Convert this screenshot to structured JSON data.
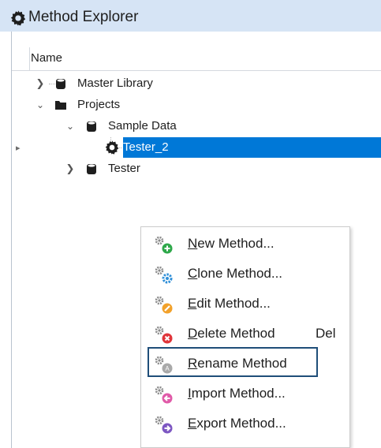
{
  "window": {
    "title": "Method Explorer",
    "icon": "gear-icon",
    "accent_color": "#0078d7",
    "title_bg": "#d6e4f5"
  },
  "grid": {
    "column_header": "Name"
  },
  "tree": {
    "items": [
      {
        "label": "Master Library",
        "icon": "database-icon",
        "state": "collapsed"
      },
      {
        "label": "Projects",
        "icon": "folder-icon",
        "state": "expanded"
      },
      {
        "label": "Sample Data",
        "icon": "database-icon",
        "state": "expanded"
      },
      {
        "label": "Tester_2",
        "icon": "gear-icon",
        "state": "leaf",
        "selected": true
      },
      {
        "label": "Tester",
        "icon": "database-icon",
        "state": "collapsed"
      }
    ]
  },
  "context_menu": {
    "items": [
      {
        "label": "New Method...",
        "mnemonic": "N",
        "rest": "ew Method...",
        "icon": "new-method-icon",
        "badge_color": "#2ea84a",
        "shortcut": ""
      },
      {
        "label": "Clone Method...",
        "mnemonic": "C",
        "rest": "lone Method...",
        "icon": "clone-method-icon",
        "badge_color": "#2f8fd8",
        "shortcut": ""
      },
      {
        "label": "Edit Method...",
        "mnemonic": "E",
        "rest": "dit Method...",
        "icon": "edit-method-icon",
        "badge_color": "#f2a12a",
        "shortcut": ""
      },
      {
        "label": "Delete Method",
        "mnemonic": "D",
        "rest": "elete Method",
        "icon": "delete-method-icon",
        "badge_color": "#e0353a",
        "shortcut": "Del"
      },
      {
        "label": "Rename Method",
        "mnemonic": "R",
        "rest": "ename Method",
        "icon": "rename-method-icon",
        "badge_color": "#a9a9a9",
        "shortcut": "",
        "focused": true
      },
      {
        "label": "Import Method...",
        "mnemonic": "I",
        "rest": "mport Method...",
        "icon": "import-method-icon",
        "badge_color": "#e05aa8",
        "shortcut": ""
      },
      {
        "label": "Export Method...",
        "mnemonic": "E",
        "rest": "xport Method...",
        "icon": "export-method-icon",
        "badge_color": "#7d57c2",
        "shortcut": ""
      }
    ]
  }
}
